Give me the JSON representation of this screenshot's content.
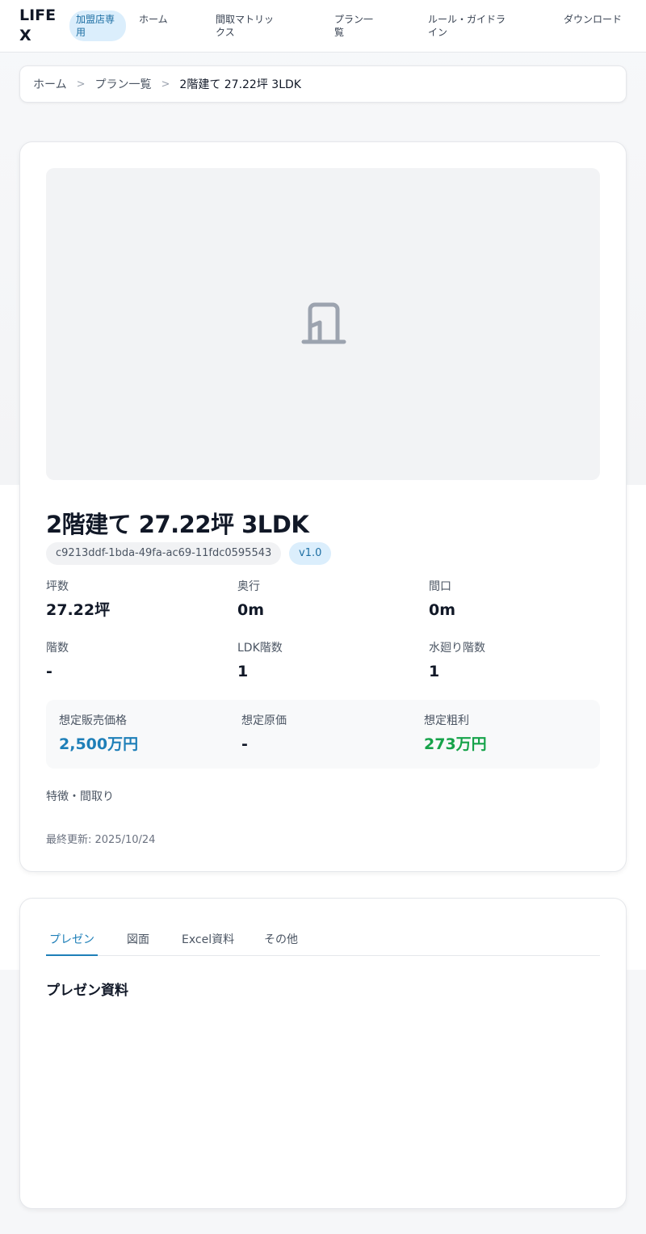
{
  "header": {
    "logo": "LIFE X",
    "member_badge": "加盟店専用",
    "nav": [
      "ホーム",
      "間取マトリックス",
      "プラン一覧",
      "ルール・ガイドライン",
      "ダウンロード"
    ]
  },
  "breadcrumb": {
    "items": [
      "ホーム",
      "プラン一覧",
      "2階建て 27.22坪 3LDK"
    ],
    "separator": ">"
  },
  "plan": {
    "image_icon": "door-icon",
    "title": "2階建て 27.22坪 3LDK",
    "id": "c9213ddf-1bda-49fa-ac69-11fdc0595543",
    "version": "v1.0",
    "specs": [
      {
        "label": "坪数",
        "value": "27.22坪"
      },
      {
        "label": "奥行",
        "value": "0m"
      },
      {
        "label": "間口",
        "value": "0m"
      },
      {
        "label": "階数",
        "value": "-"
      },
      {
        "label": "LDK階数",
        "value": "1"
      },
      {
        "label": "水廻り階数",
        "value": "1"
      }
    ],
    "prices": [
      {
        "label": "想定販売価格",
        "value": "2,500万円",
        "color": "#1e7fb8"
      },
      {
        "label": "想定原価",
        "value": "-",
        "color": "#111827"
      },
      {
        "label": "想定粗利",
        "value": "273万円",
        "color": "#16a34a"
      }
    ],
    "features_label": "特徴・間取り",
    "updated": "最終更新: 2025/10/24"
  },
  "documents": {
    "tabs": [
      "プレゼン",
      "図面",
      "Excel資料",
      "その他"
    ],
    "active_tab": "プレゼン",
    "heading": "プレゼン資料"
  }
}
